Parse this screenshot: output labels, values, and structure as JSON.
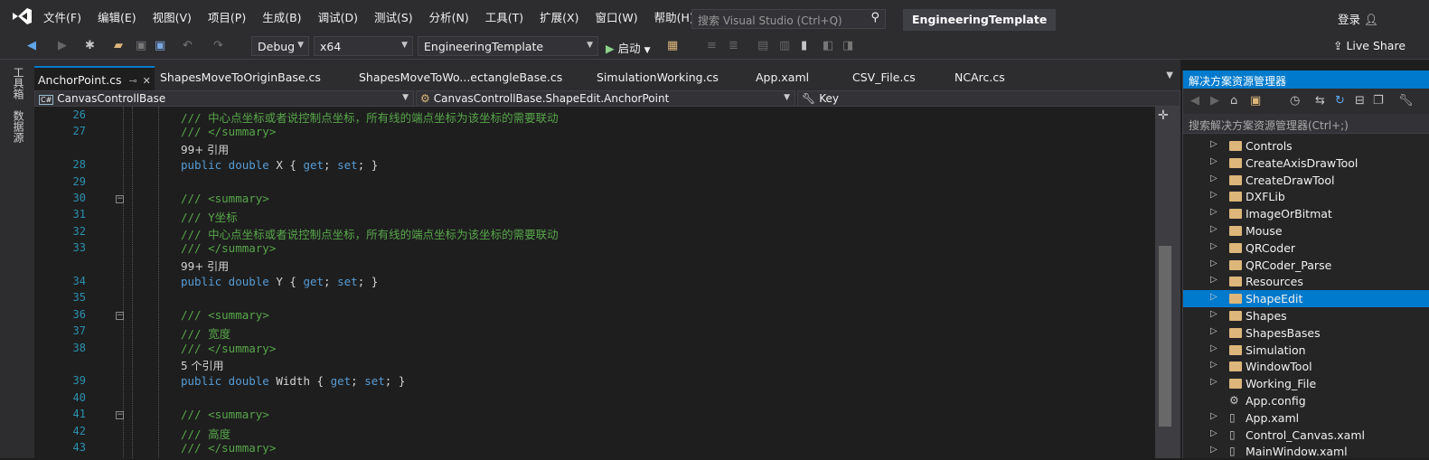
{
  "titlebar": {
    "menus": [
      "文件(F)",
      "编辑(E)",
      "视图(V)",
      "项目(P)",
      "生成(B)",
      "调试(D)",
      "测试(S)",
      "分析(N)",
      "工具(T)",
      "扩展(X)",
      "窗口(W)",
      "帮助(H)"
    ],
    "search_placeholder": "搜索 Visual Studio (Ctrl+Q)",
    "solution_name": "EngineeringTemplate",
    "login_label": "登录"
  },
  "toolbar": {
    "config": "Debug",
    "platform": "x64",
    "startup_project": "EngineeringTemplate",
    "start_label": "启动",
    "live_share": "Live Share"
  },
  "side_tabs": [
    "工具箱",
    "数据源"
  ],
  "editor_tabs": [
    {
      "label": "AnchorPoint.cs",
      "active": true
    },
    {
      "label": "ShapesMoveToOriginBase.cs"
    },
    {
      "label": "ShapesMoveToWo...ectangleBase.cs"
    },
    {
      "label": "SimulationWorking.cs"
    },
    {
      "label": "App.xaml"
    },
    {
      "label": "CSV_File.cs"
    },
    {
      "label": "NCArc.cs"
    }
  ],
  "navbar": {
    "project": "CanvasControllBase",
    "type": "CanvasControllBase.ShapeEdit.AnchorPoint",
    "member": "Key",
    "project_badge": "C#"
  },
  "code_lines": [
    {
      "n": "26",
      "text": "/// 中心点坐标或者说控制点坐标，所有线的端点坐标为该坐标的需要联动",
      "cls": "cm"
    },
    {
      "n": "27",
      "text": "/// </summary>",
      "cls": "cm"
    },
    {
      "n": "",
      "text": "99+ 引用",
      "cls": "ref"
    },
    {
      "n": "28",
      "parts": [
        [
          "kw",
          "public double "
        ],
        [
          "id",
          "X { "
        ],
        [
          "kw",
          "get"
        ],
        [
          "id",
          "; "
        ],
        [
          "kw",
          "set"
        ],
        [
          "id",
          "; }"
        ]
      ]
    },
    {
      "n": "29",
      "text": ""
    },
    {
      "n": "30",
      "text": "/// <summary>",
      "cls": "cm",
      "fold": true
    },
    {
      "n": "31",
      "text": "/// Y坐标",
      "cls": "cm"
    },
    {
      "n": "32",
      "text": "/// 中心点坐标或者说控制点坐标，所有线的端点坐标为该坐标的需要联动",
      "cls": "cm"
    },
    {
      "n": "33",
      "text": "/// </summary>",
      "cls": "cm"
    },
    {
      "n": "",
      "text": "99+ 引用",
      "cls": "ref"
    },
    {
      "n": "34",
      "parts": [
        [
          "kw",
          "public double "
        ],
        [
          "id",
          "Y { "
        ],
        [
          "kw",
          "get"
        ],
        [
          "id",
          "; "
        ],
        [
          "kw",
          "set"
        ],
        [
          "id",
          "; }"
        ]
      ]
    },
    {
      "n": "35",
      "text": ""
    },
    {
      "n": "36",
      "text": "/// <summary>",
      "cls": "cm",
      "fold": true
    },
    {
      "n": "37",
      "text": "/// 宽度",
      "cls": "cm"
    },
    {
      "n": "38",
      "text": "/// </summary>",
      "cls": "cm"
    },
    {
      "n": "",
      "text": "5 个引用",
      "cls": "ref"
    },
    {
      "n": "39",
      "parts": [
        [
          "kw",
          "public double "
        ],
        [
          "id",
          "Width { "
        ],
        [
          "kw",
          "get"
        ],
        [
          "id",
          "; "
        ],
        [
          "kw",
          "set"
        ],
        [
          "id",
          "; }"
        ]
      ]
    },
    {
      "n": "40",
      "text": ""
    },
    {
      "n": "41",
      "text": "/// <summary>",
      "cls": "cm",
      "fold": true
    },
    {
      "n": "42",
      "text": "/// 高度",
      "cls": "cm"
    },
    {
      "n": "43",
      "text": "/// </summary>",
      "cls": "cm"
    }
  ],
  "solution_explorer": {
    "title": "解决方案资源管理器",
    "search_placeholder": "搜索解决方案资源管理器(Ctrl+;)",
    "items": [
      {
        "label": "Controls",
        "kind": "folder"
      },
      {
        "label": "CreateAxisDrawTool",
        "kind": "folder"
      },
      {
        "label": "CreateDrawTool",
        "kind": "folder"
      },
      {
        "label": "DXFLib",
        "kind": "folder"
      },
      {
        "label": "ImageOrBitmat",
        "kind": "folder"
      },
      {
        "label": "Mouse",
        "kind": "folder"
      },
      {
        "label": "QRCoder",
        "kind": "folder"
      },
      {
        "label": "QRCoder_Parse",
        "kind": "folder"
      },
      {
        "label": "Resources",
        "kind": "folder"
      },
      {
        "label": "ShapeEdit",
        "kind": "folder",
        "selected": true
      },
      {
        "label": "Shapes",
        "kind": "folder"
      },
      {
        "label": "ShapesBases",
        "kind": "folder"
      },
      {
        "label": "Simulation",
        "kind": "folder"
      },
      {
        "label": "WindowTool",
        "kind": "folder"
      },
      {
        "label": "Working_File",
        "kind": "folder"
      },
      {
        "label": "App.config",
        "kind": "config"
      },
      {
        "label": "App.xaml",
        "kind": "file"
      },
      {
        "label": "Control_Canvas.xaml",
        "kind": "file"
      },
      {
        "label": "MainWindow.xaml",
        "kind": "file"
      }
    ]
  },
  "colors": {
    "accent": "#007acc",
    "comment": "#57a64a",
    "keyword": "#569cd6",
    "line_number": "#2b91af"
  }
}
